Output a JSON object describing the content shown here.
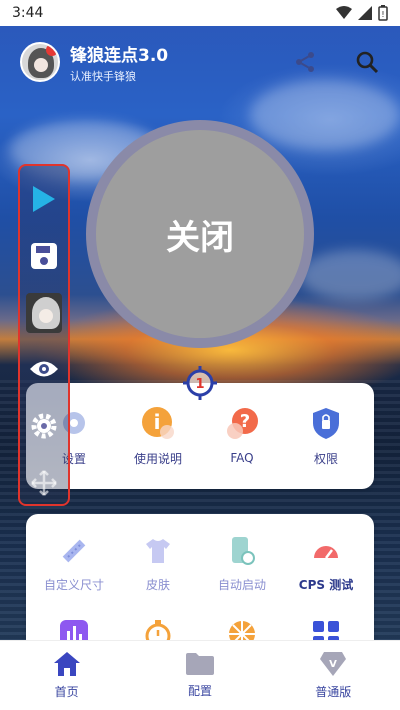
{
  "status": {
    "time": "3:44"
  },
  "header": {
    "title": "锋狼连点3.0",
    "subtitle": "认准快手锋狼"
  },
  "main": {
    "circle_label": "关闭",
    "target_number": "1"
  },
  "quick_card": {
    "items": [
      {
        "label": "设置",
        "icon": "gear-icon"
      },
      {
        "label": "使用说明",
        "icon": "info-icon"
      },
      {
        "label": "FAQ",
        "icon": "question-icon"
      },
      {
        "label": "权限",
        "icon": "shield-icon"
      }
    ]
  },
  "feature_card": {
    "items": [
      {
        "label": "自定义尺寸",
        "icon": "ruler-icon"
      },
      {
        "label": "皮肤",
        "icon": "shirt-icon"
      },
      {
        "label": "自动启动",
        "icon": "phone-icon"
      },
      {
        "label": "CPS 测试",
        "icon": "speedometer-icon"
      },
      {
        "label": "",
        "icon": "bar-chart-icon"
      },
      {
        "label": "",
        "icon": "stopwatch-icon"
      },
      {
        "label": "",
        "icon": "wheel-icon"
      },
      {
        "label": "",
        "icon": "grid-icon"
      }
    ]
  },
  "bottom_nav": {
    "items": [
      {
        "label": "首页",
        "icon": "home-icon"
      },
      {
        "label": "配置",
        "icon": "folder-icon"
      },
      {
        "label": "普通版",
        "icon": "diamond-icon"
      }
    ]
  },
  "colors": {
    "accent": "#3a46a0",
    "toolbar_border": "#e0342c",
    "circle": "#9e9e9e"
  }
}
